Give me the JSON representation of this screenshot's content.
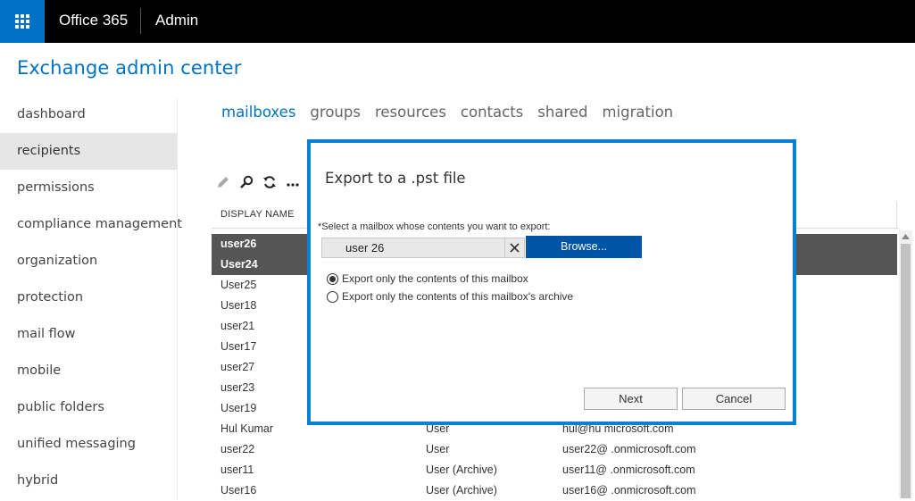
{
  "header": {
    "brand": "Office 365",
    "section": "Admin"
  },
  "app_title": "Exchange admin center",
  "nav": {
    "items": [
      {
        "label": "dashboard"
      },
      {
        "label": "recipients"
      },
      {
        "label": "permissions"
      },
      {
        "label": "compliance management"
      },
      {
        "label": "organization"
      },
      {
        "label": "protection"
      },
      {
        "label": "mail flow"
      },
      {
        "label": "mobile"
      },
      {
        "label": "public folders"
      },
      {
        "label": "unified messaging"
      },
      {
        "label": "hybrid"
      }
    ],
    "active": "recipients"
  },
  "tabs": [
    {
      "label": "mailboxes"
    },
    {
      "label": "groups"
    },
    {
      "label": "resources"
    },
    {
      "label": "contacts"
    },
    {
      "label": "shared"
    },
    {
      "label": "migration"
    }
  ],
  "toolbar": {
    "icons": [
      "pencil-icon",
      "search-icon",
      "refresh-icon",
      "more-icon"
    ],
    "more_label": "..."
  },
  "table": {
    "columns": [
      "DISPLAY NAME"
    ],
    "rows": [
      {
        "name": "user26",
        "type": "",
        "email": "",
        "selected": true
      },
      {
        "name": "User24",
        "type": "",
        "email": "",
        "selected": true
      },
      {
        "name": "User25",
        "type": "",
        "email": ""
      },
      {
        "name": "User18",
        "type": "",
        "email": ""
      },
      {
        "name": "user21",
        "type": "",
        "email": ""
      },
      {
        "name": "User17",
        "type": "",
        "email": ""
      },
      {
        "name": "user27",
        "type": "",
        "email": ""
      },
      {
        "name": "user23",
        "type": "",
        "email": ""
      },
      {
        "name": "User19",
        "type": "",
        "email": ""
      },
      {
        "name": "Hul Kumar",
        "type": "User",
        "email": "hul@hu microsoft.com"
      },
      {
        "name": "user22",
        "type": "User",
        "email": "user22@ .onmicrosoft.com"
      },
      {
        "name": "user11",
        "type": "User (Archive)",
        "email": "user11@ .onmicrosoft.com"
      },
      {
        "name": "User16",
        "type": "User (Archive)",
        "email": "user16@ .onmicrosoft.com"
      }
    ]
  },
  "dialog": {
    "title": "Export to a .pst file",
    "mailbox_label": "*Select a mailbox whose contents you want to export:",
    "mailbox_value": "user 26",
    "clear_glyph": "✕",
    "browse_label": "Browse...",
    "options": [
      {
        "label": "Export only the contents of this mailbox",
        "checked": true
      },
      {
        "label": "Export only the contents of this mailbox's archive",
        "checked": false
      }
    ],
    "next_label": "Next",
    "cancel_label": "Cancel"
  },
  "colors": {
    "accent": "#0072c6",
    "topbar": "#000000",
    "dialog_border": "#0a7fd6",
    "browse_button": "#0054a6",
    "selected_row": "#555555"
  }
}
